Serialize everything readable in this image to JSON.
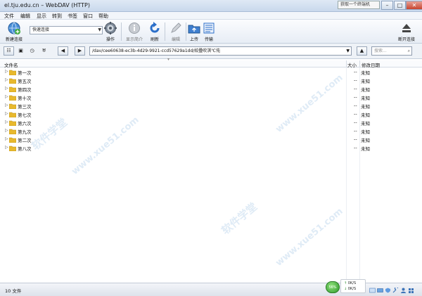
{
  "window": {
    "title": "el.tju.edu.cn – WebDAV (HTTP)",
    "ad_text": "获取一个终端机",
    "minimize": "–",
    "maximize": "□",
    "close": "✕"
  },
  "menu": [
    "文件",
    "编辑",
    "显示",
    "转到",
    "书签",
    "窗口",
    "帮助"
  ],
  "toolbar": {
    "new_connection": "新建连接",
    "quick_connect": "快速连接",
    "action": "操作",
    "show_info": "显示简介",
    "refresh": "刷新",
    "edit": "编辑",
    "upload": "上传",
    "transfers": "传输",
    "disconnect": "断开连接"
  },
  "nav": {
    "path": "/dav/cee60638-ec3b-4d29-9921-ccd57629a1dd/姣曡吹淇℃伅",
    "search_placeholder": "搜索..."
  },
  "columns": {
    "name": "文件名",
    "size": "大小",
    "modified": "修改日期"
  },
  "files": [
    {
      "name": "第一次",
      "size": "--",
      "modified": "未知"
    },
    {
      "name": "第五次",
      "size": "--",
      "modified": "未知"
    },
    {
      "name": "第四次",
      "size": "--",
      "modified": "未知"
    },
    {
      "name": "第十次",
      "size": "--",
      "modified": "未知"
    },
    {
      "name": "第三次",
      "size": "--",
      "modified": "未知"
    },
    {
      "name": "第七次",
      "size": "--",
      "modified": "未知"
    },
    {
      "name": "第六次",
      "size": "--",
      "modified": "未知"
    },
    {
      "name": "第九次",
      "size": "--",
      "modified": "未知"
    },
    {
      "name": "第二次",
      "size": "--",
      "modified": "未知"
    },
    {
      "name": "第八次",
      "size": "--",
      "modified": "未知"
    }
  ],
  "status": {
    "count": "10 文件"
  },
  "network": {
    "percent": "56%",
    "up": "0K/S",
    "down": "0K/S"
  },
  "watermark": [
    "软件学堂",
    "www.xue51.com"
  ],
  "colors": {
    "accent": "#2f6fd0",
    "folder": "#e8b92e",
    "titlebar": "#c9d8ec"
  }
}
